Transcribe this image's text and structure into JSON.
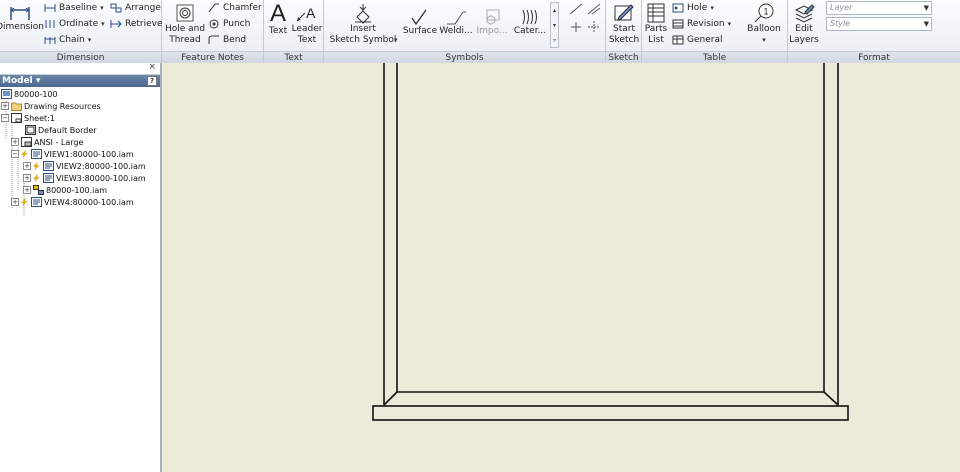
{
  "ribbon": {
    "dimension": {
      "title": "Dimension",
      "dimension_label": "Dimension",
      "baseline": "Baseline",
      "ordinate": "Ordinate",
      "chain": "Chain",
      "arrange": "Arrange",
      "retrieve": "Retrieve"
    },
    "feature_notes": {
      "title": "Feature Notes",
      "hole_and_thread_1": "Hole and",
      "hole_and_thread_2": "Thread",
      "chamfer": "Chamfer",
      "punch": "Punch",
      "bend": "Bend"
    },
    "text": {
      "title": "Text",
      "text": "Text",
      "leader_1": "Leader",
      "leader_2": "Text"
    },
    "symbols": {
      "title": "Symbols",
      "insert_1": "Insert",
      "insert_2": "Sketch Symbol",
      "surface": "Surface",
      "welding": "Weldi...",
      "import": "Impo...",
      "caterpillar": "Cater..."
    },
    "sketch": {
      "title": "Sketch",
      "start_1": "Start",
      "start_2": "Sketch"
    },
    "table": {
      "title": "Table",
      "parts_1": "Parts",
      "parts_2": "List",
      "hole": "Hole",
      "revision": "Revision",
      "general": "General"
    },
    "balloon": {
      "label": "Balloon",
      "number": "1"
    },
    "format": {
      "title": "Format",
      "edit_1": "Edit",
      "edit_2": "Layers",
      "layer_placeholder": "Layer",
      "style_placeholder": "Style"
    }
  },
  "browser": {
    "close": "×",
    "model_label": "Model ▾",
    "help": "?",
    "items": [
      {
        "label": "80000-100"
      },
      {
        "label": "Drawing Resources"
      },
      {
        "label": "Sheet:1"
      },
      {
        "label": "Default Border"
      },
      {
        "label": "ANSI - Large"
      },
      {
        "label": "VIEW1:80000-100.iam"
      },
      {
        "label": "VIEW2:80000-100.iam"
      },
      {
        "label": "VIEW3:80000-100.iam"
      },
      {
        "label": "80000-100.iam"
      },
      {
        "label": "VIEW4:80000-100.iam"
      }
    ]
  },
  "colors": {
    "canvas": "#ecead8",
    "model_bar": "#5676a0"
  }
}
